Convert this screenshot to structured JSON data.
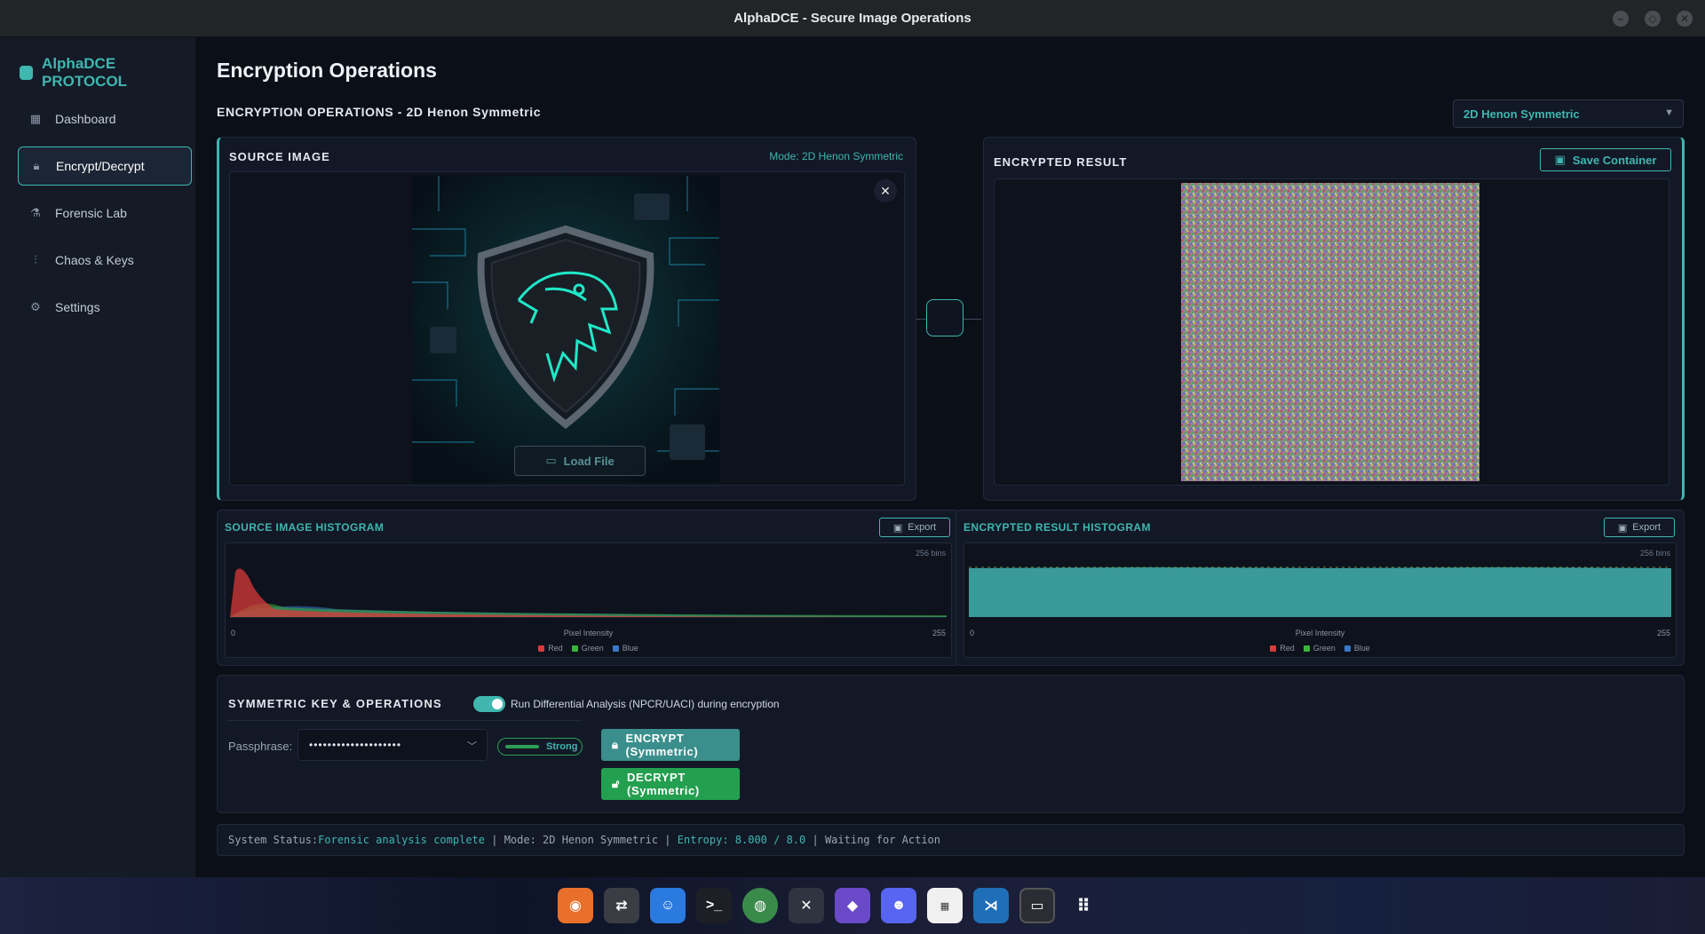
{
  "window": {
    "title": "AlphaDCE - Secure Image Operations",
    "controls": [
      "minimize-icon",
      "maximize-icon",
      "close-icon"
    ]
  },
  "sidebar": {
    "brand": "AlphaDCE PROTOCOL",
    "items": [
      {
        "label": "Dashboard",
        "icon": "dashboard-icon"
      },
      {
        "label": "Encrypt/Decrypt",
        "icon": "lock-icon",
        "active": true
      },
      {
        "label": "Forensic Lab",
        "icon": "flask-icon"
      },
      {
        "label": "Chaos & Keys",
        "icon": "sliders-icon"
      },
      {
        "label": "Settings",
        "icon": "gear-icon"
      }
    ]
  },
  "main": {
    "page_title": "Encryption Operations",
    "subheading": "ENCRYPTION OPERATIONS - 2D Henon Symmetric",
    "mode_select": {
      "selected": "2D Henon Symmetric"
    }
  },
  "source_panel": {
    "title": "SOURCE IMAGE",
    "mode_tag": "Mode: 2D Henon Symmetric",
    "load_button": "Load File"
  },
  "encrypted_panel": {
    "title": "ENCRYPTED RESULT",
    "save_button": "Save Container"
  },
  "source_histogram": {
    "title": "SOURCE IMAGE HISTOGRAM",
    "export": "Export",
    "bins": "256 bins",
    "xmin": "0",
    "xmax": "255",
    "xlabel": "Pixel Intensity"
  },
  "encrypted_histogram": {
    "title": "ENCRYPTED RESULT HISTOGRAM",
    "export": "Export",
    "bins": "256 bins",
    "xmin": "0",
    "xmax": "255",
    "xlabel": "Pixel Intensity"
  },
  "legend": {
    "red": "Red",
    "green": "Green",
    "blue": "Blue",
    "red_color": "#d93a3a",
    "green_color": "#3ab43a",
    "blue_color": "#3a78c8"
  },
  "key_panel": {
    "title": "SYMMETRIC KEY & OPERATIONS",
    "toggle_label": "Run Differential Analysis (NPCR/UACI) during encryption",
    "toggle_on": true,
    "passphrase_label": "Passphrase:",
    "passphrase_value": "••••••••••••••••••••",
    "strength": "Strong",
    "encrypt_button": "ENCRYPT (Symmetric)",
    "decrypt_button": "DECRYPT (Symmetric)"
  },
  "status": {
    "label": "System Status:",
    "state": "Forensic analysis complete",
    "mode": "Mode: 2D Henon Symmetric",
    "entropy": "Entropy: 8.000 / 8.0",
    "action": "Waiting for Action"
  },
  "colors": {
    "accent": "#3fb6b0",
    "encrypt": "#3a8f8c",
    "decrypt": "#23a04f"
  },
  "dock": {
    "apps": [
      "firefox-icon",
      "network-icon",
      "finder-icon",
      "terminal-icon",
      "bottle-icon",
      "tools-icon",
      "obsidian-icon",
      "discord-icon",
      "calendar-icon",
      "vscode-icon",
      "monitor-icon",
      "app-grid-icon"
    ]
  }
}
